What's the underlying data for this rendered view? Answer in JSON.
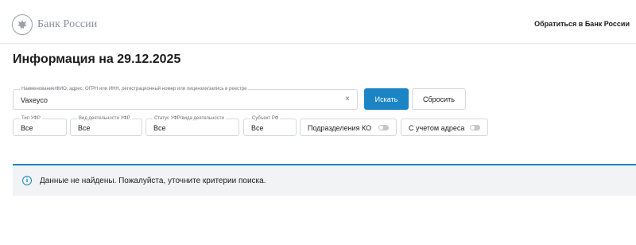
{
  "header": {
    "logo_text": "Банк России",
    "contact_link": "Обратиться в Банк России"
  },
  "page_title": "Информация на 29.12.2025",
  "search": {
    "label": "Наименование/ФИО, адрес, ОГРН или ИНН, регистрационный номер или лицензия/запись в реестре",
    "value": "Vaxeyco",
    "clear_icon": "×"
  },
  "buttons": {
    "search_label": "Искать",
    "reset_label": "Сбросить"
  },
  "filters": [
    {
      "label": "Тип УФР",
      "value": "Все"
    },
    {
      "label": "Вид деятельности УФР",
      "value": "Все"
    },
    {
      "label": "Статус УФР/вида деятельности",
      "value": "Все"
    },
    {
      "label": "Субъект РФ",
      "value": "Все"
    }
  ],
  "toggles": [
    {
      "label": "Подразделения КО",
      "on": false
    },
    {
      "label": "С учетом адреса",
      "on": false
    }
  ],
  "notice": {
    "icon": "i",
    "text": "Данные не найдены. Пожалуйста, уточните критерии поиска."
  },
  "colors": {
    "accent": "#1b84c4",
    "notice_bg": "#f1f3f4",
    "toggle_off": "#c3c7cb"
  }
}
